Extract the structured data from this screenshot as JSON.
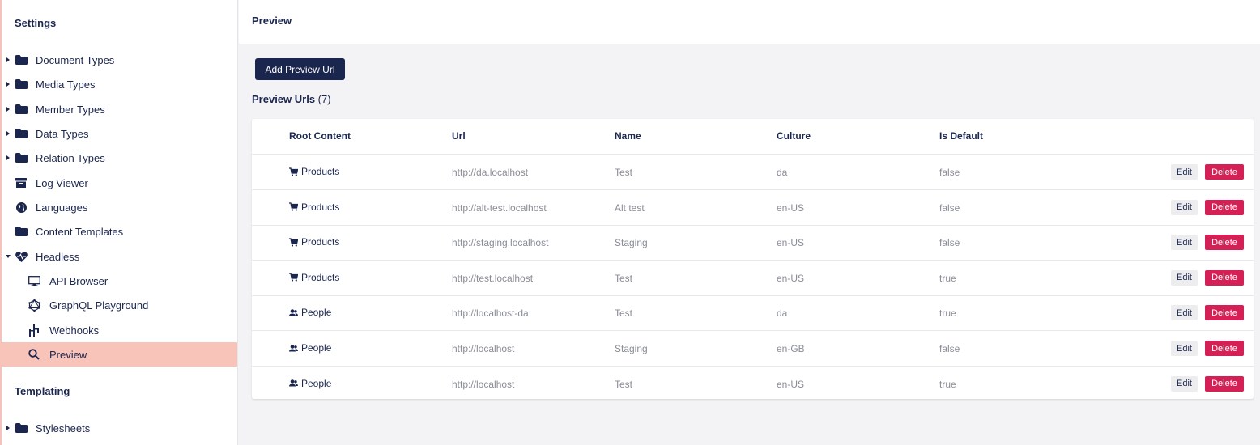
{
  "sidebar": {
    "settings_title": "Settings",
    "templating_title": "Templating",
    "items": [
      {
        "label": "Document Types",
        "icon": "folder-icon"
      },
      {
        "label": "Media Types",
        "icon": "folder-icon"
      },
      {
        "label": "Member Types",
        "icon": "folder-icon"
      },
      {
        "label": "Data Types",
        "icon": "folder-icon"
      },
      {
        "label": "Relation Types",
        "icon": "folder-icon"
      },
      {
        "label": "Log Viewer",
        "icon": "box-icon"
      },
      {
        "label": "Languages",
        "icon": "globe-icon"
      },
      {
        "label": "Content Templates",
        "icon": "folder-icon"
      },
      {
        "label": "Headless",
        "icon": "heart-icon"
      },
      {
        "label": "API Browser",
        "icon": "monitor-icon"
      },
      {
        "label": "GraphQL Playground",
        "icon": "graphql-icon"
      },
      {
        "label": "Webhooks",
        "icon": "webhook-icon"
      },
      {
        "label": "Preview",
        "icon": "search-icon"
      }
    ],
    "templating_items": [
      {
        "label": "Stylesheets",
        "icon": "folder-icon"
      }
    ],
    "active_color": "#f8c3b9"
  },
  "header": {
    "title": "Preview"
  },
  "main": {
    "add_button_label": "Add Preview Url",
    "list_title": "Preview Urls",
    "list_count": "(7)",
    "columns": [
      "Root Content",
      "Url",
      "Name",
      "Culture",
      "Is Default"
    ],
    "rows": [
      {
        "root": "Products",
        "root_icon": "cart-icon",
        "url": "http://da.localhost",
        "name": "Test",
        "culture": "da",
        "is_default": "false"
      },
      {
        "root": "Products",
        "root_icon": "cart-icon",
        "url": "http://alt-test.localhost",
        "name": "Alt test",
        "culture": "en-US",
        "is_default": "false"
      },
      {
        "root": "Products",
        "root_icon": "cart-icon",
        "url": "http://staging.localhost",
        "name": "Staging",
        "culture": "en-US",
        "is_default": "false"
      },
      {
        "root": "Products",
        "root_icon": "cart-icon",
        "url": "http://test.localhost",
        "name": "Test",
        "culture": "en-US",
        "is_default": "true"
      },
      {
        "root": "People",
        "root_icon": "people-icon",
        "url": "http://localhost-da",
        "name": "Test",
        "culture": "da",
        "is_default": "true"
      },
      {
        "root": "People",
        "root_icon": "people-icon",
        "url": "http://localhost",
        "name": "Staging",
        "culture": "en-GB",
        "is_default": "false"
      },
      {
        "root": "People",
        "root_icon": "people-icon",
        "url": "http://localhost",
        "name": "Test",
        "culture": "en-US",
        "is_default": "true"
      }
    ],
    "edit_label": "Edit",
    "delete_label": "Delete"
  },
  "colors": {
    "primary": "#1b264f",
    "danger": "#d42054",
    "active": "#f8c3b9"
  }
}
